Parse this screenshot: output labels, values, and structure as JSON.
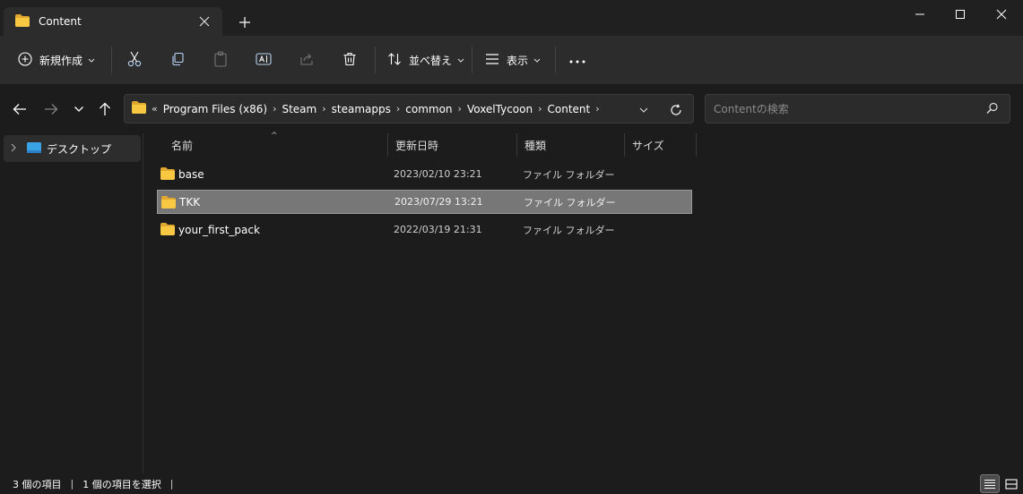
{
  "window": {
    "tab_title": "Content",
    "new_tab_glyph": "+"
  },
  "toolbar": {
    "new_label": "新規作成",
    "sort_label": "並べ替え",
    "view_label": "表示",
    "icons": [
      "new-icon",
      "cut-icon",
      "copy-icon",
      "paste-icon",
      "rename-icon",
      "share-icon",
      "delete-icon",
      "sort-icon",
      "view-icon",
      "more-icon"
    ]
  },
  "address": {
    "overflow": "«",
    "crumbs": [
      "Program Files (x86)",
      "Steam",
      "steamapps",
      "common",
      "VoxelTycoon",
      "Content"
    ],
    "separator": "›"
  },
  "search": {
    "placeholder": "Contentの検索",
    "value": ""
  },
  "navpane": {
    "items": [
      {
        "label": "デスクトップ",
        "icon": "desktop-icon"
      }
    ]
  },
  "columns": {
    "name": "名前",
    "modified": "更新日時",
    "type": "種類",
    "size": "サイズ"
  },
  "files": [
    {
      "name": "base",
      "modified": "2023/02/10 23:21",
      "type": "ファイル フォルダー",
      "size": "",
      "selected": false
    },
    {
      "name": "TKK",
      "modified": "2023/07/29 13:21",
      "type": "ファイル フォルダー",
      "size": "",
      "selected": true
    },
    {
      "name": "your_first_pack",
      "modified": "2022/03/19 21:31",
      "type": "ファイル フォルダー",
      "size": "",
      "selected": false
    }
  ],
  "status": {
    "item_count": "3 個の項目",
    "selected_count": "1 個の項目を選択",
    "separator": "|"
  },
  "colors": {
    "folder": "#f8c842",
    "folder_dark": "#e0a82e",
    "selection": "#777777",
    "background": "#1c1c1c"
  }
}
